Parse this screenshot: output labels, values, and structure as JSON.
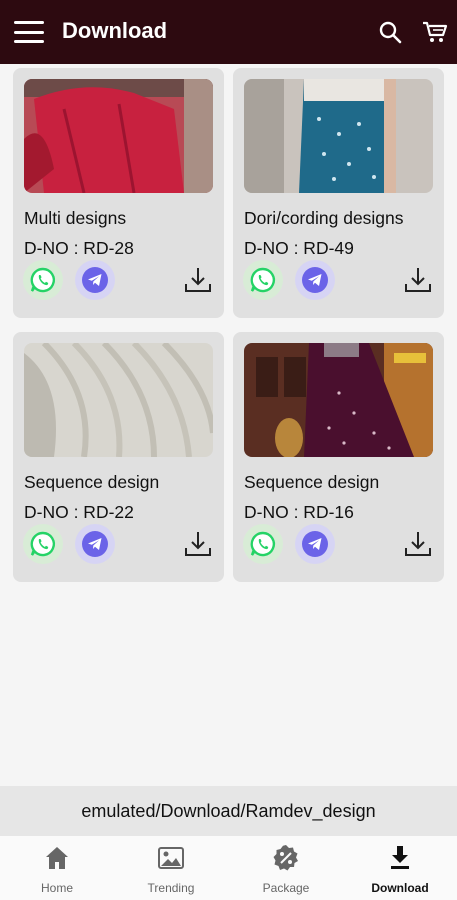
{
  "app_bar": {
    "title": "Download"
  },
  "cards": [
    {
      "name": "Multi designs",
      "code": "D-NO : RD-28"
    },
    {
      "name": "Dori/cording designs",
      "code": "D-NO : RD-49"
    },
    {
      "name": "Sequence design",
      "code": "D-NO : RD-22"
    },
    {
      "name": "Sequence design",
      "code": "D-NO : RD-16"
    }
  ],
  "path_bar": {
    "text": "emulated/Download/Ramdev_design"
  },
  "bottom_nav": [
    {
      "label": "Home",
      "icon": "home-icon"
    },
    {
      "label": "Trending",
      "icon": "image-icon"
    },
    {
      "label": "Package",
      "icon": "package-badge-icon"
    },
    {
      "label": "Download",
      "icon": "download-icon",
      "active": true
    }
  ],
  "colors": {
    "app_bar": "#2d0a10",
    "whatsapp": "#25d366",
    "telegram": "#6b63e8"
  }
}
